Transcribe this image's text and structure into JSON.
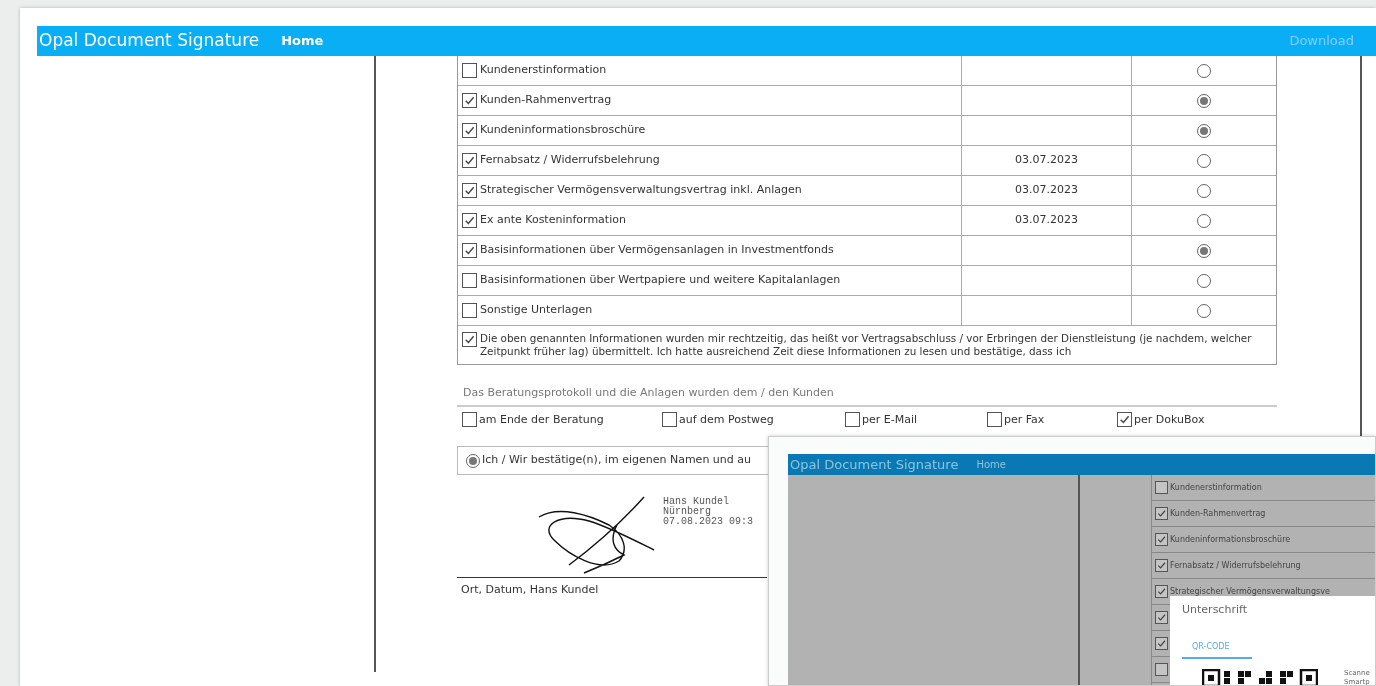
{
  "header": {
    "title": "Opal Document Signature",
    "nav": [
      {
        "label": "Home"
      }
    ],
    "action": "Download"
  },
  "documents": [
    {
      "label": "Kundenerstinformation",
      "checked": false,
      "selected": false
    },
    {
      "label": "Kunden-Rahmenvertrag",
      "checked": true,
      "selected": true
    },
    {
      "label": "Kundeninformationsbroschüre",
      "checked": true,
      "selected": true
    },
    {
      "label": "Fernabsatz / Widerrufsbelehrung",
      "checked": true,
      "date": "03.07.2023",
      "selected": false
    },
    {
      "label": "Strategischer Vermögensverwaltungsvertrag inkl. Anlagen",
      "checked": true,
      "date": "03.07.2023",
      "selected": false
    },
    {
      "label": "Ex ante Kosteninformation",
      "checked": true,
      "date": "03.07.2023",
      "selected": false
    },
    {
      "label": "Basisinformationen über Vermögensanlagen in Investmentfonds",
      "checked": true,
      "selected": true
    },
    {
      "label": "Basisinformationen über Wertpapiere und weitere Kapitalanlagen",
      "checked": false,
      "selected": false
    },
    {
      "label": "Sonstige Unterlagen",
      "checked": false,
      "selected": false
    }
  ],
  "confirmation": {
    "checked": true,
    "text": "Die oben genannten Informationen wurden mir rechtzeitig, das heißt vor Vertragsabschluss / vor Erbringen der Dienstleistung (je nachdem, welcher Zeitpunkt früher lag) übermittelt. Ich hatte ausreichend Zeit diese Informationen zu lesen und bestätige, dass ich"
  },
  "delivery": {
    "heading": "Das Beratungsprotokoll und die Anlagen wurden dem / den Kunden",
    "options": [
      {
        "label": "am Ende der Beratung",
        "checked": false
      },
      {
        "label": "auf dem Postweg",
        "checked": false
      },
      {
        "label": "per E-Mail",
        "checked": false
      },
      {
        "label": "per Fax",
        "checked": false
      },
      {
        "label": "per DokuBox",
        "checked": true
      }
    ]
  },
  "declaration": {
    "selected": true,
    "text": "Ich / Wir bestätige(n), im eigenen Namen und au"
  },
  "signature": {
    "stamp": [
      "Hans Kundel",
      "Nürnberg",
      "07.08.2023 09:3"
    ],
    "caption": "Ort, Datum, Hans Kundel"
  },
  "preview": {
    "title": "Opal Document Signature",
    "nav": "Home",
    "rows": [
      {
        "label": "Kundenerstinformation",
        "checked": false
      },
      {
        "label": "Kunden-Rahmenvertrag",
        "checked": true
      },
      {
        "label": "Kundeninformationsbroschüre",
        "checked": true
      },
      {
        "label": "Fernabsatz / Widerrufsbelehrung",
        "checked": true
      },
      {
        "label": "Strategischer Vermögensverwaltungsve",
        "checked": true
      },
      {
        "checked": true
      },
      {
        "checked": true
      },
      {
        "checked": false
      }
    ],
    "dialog": {
      "title": "Unterschrift",
      "tab": "QR-CODE",
      "hint": [
        "Scanne",
        "Smartp"
      ]
    }
  }
}
